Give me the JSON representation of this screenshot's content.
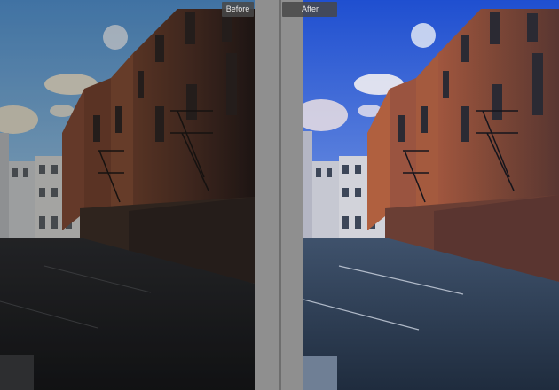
{
  "compare": {
    "before_label": "Before",
    "after_label": "After"
  },
  "colors": {
    "panel_bg": "#989898",
    "label_bg": "#484848",
    "label_text": "#e6e6e6"
  }
}
